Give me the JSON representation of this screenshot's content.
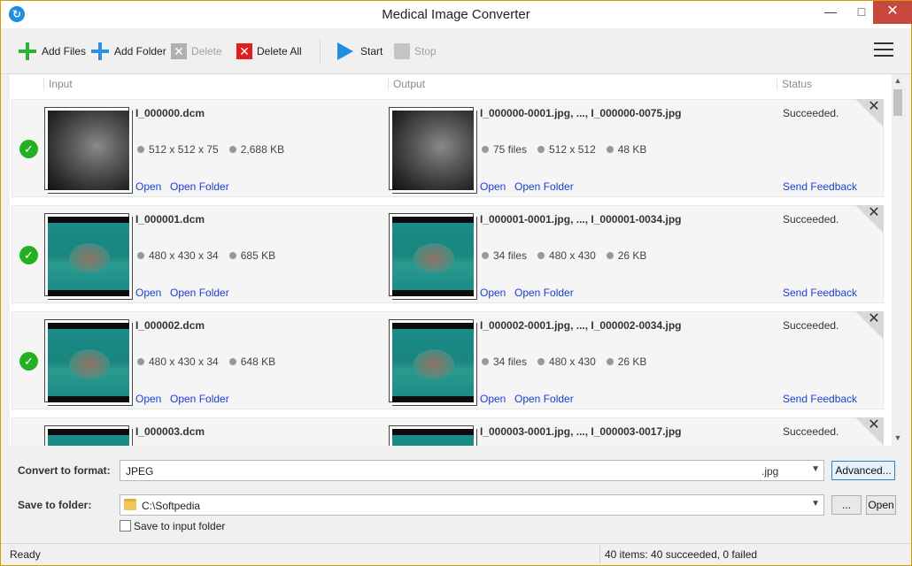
{
  "window": {
    "title": "Medical Image Converter",
    "app_icon": "refresh-icon"
  },
  "toolbar": {
    "add_files": "Add Files",
    "add_folder": "Add Folder",
    "delete": "Delete",
    "delete_all": "Delete All",
    "start": "Start",
    "stop": "Stop"
  },
  "columns": {
    "input": "Input",
    "output": "Output",
    "status": "Status"
  },
  "items": [
    {
      "input_name": "I_000000.dcm",
      "input_dims": "512 x 512 x 75",
      "input_size": "2,688 KB",
      "output_name": "I_000000-0001.jpg, ..., I_000000-0075.jpg",
      "output_count": "75 files",
      "output_dims": "512 x 512",
      "output_size": "48 KB",
      "status": "Succeeded.",
      "open": "Open",
      "open_folder": "Open Folder",
      "feedback": "Send Feedback",
      "thumb": "xray"
    },
    {
      "input_name": "I_000001.dcm",
      "input_dims": "480 x 430 x 34",
      "input_size": "685 KB",
      "output_name": "I_000001-0001.jpg, ..., I_000001-0034.jpg",
      "output_count": "34 files",
      "output_dims": "480 x 430",
      "output_size": "26 KB",
      "status": "Succeeded.",
      "open": "Open",
      "open_folder": "Open Folder",
      "feedback": "Send Feedback",
      "thumb": "echo"
    },
    {
      "input_name": "I_000002.dcm",
      "input_dims": "480 x 430 x 34",
      "input_size": "648 KB",
      "output_name": "I_000002-0001.jpg, ..., I_000002-0034.jpg",
      "output_count": "34 files",
      "output_dims": "480 x 430",
      "output_size": "26 KB",
      "status": "Succeeded.",
      "open": "Open",
      "open_folder": "Open Folder",
      "feedback": "Send Feedback",
      "thumb": "echo"
    },
    {
      "input_name": "I_000003.dcm",
      "output_name": "I_000003-0001.jpg, ..., I_000003-0017.jpg",
      "status": "Succeeded.",
      "thumb": "echo"
    }
  ],
  "format": {
    "label": "Convert to format:",
    "value": "JPEG",
    "ext": ".jpg",
    "advanced": "Advanced..."
  },
  "folder": {
    "label": "Save to folder:",
    "path": "C:\\Softpedia",
    "browse": "...",
    "open": "Open",
    "save_to_input": "Save to input folder"
  },
  "statusbar": {
    "left": "Ready",
    "right": "40 items: 40 succeeded, 0 failed"
  }
}
